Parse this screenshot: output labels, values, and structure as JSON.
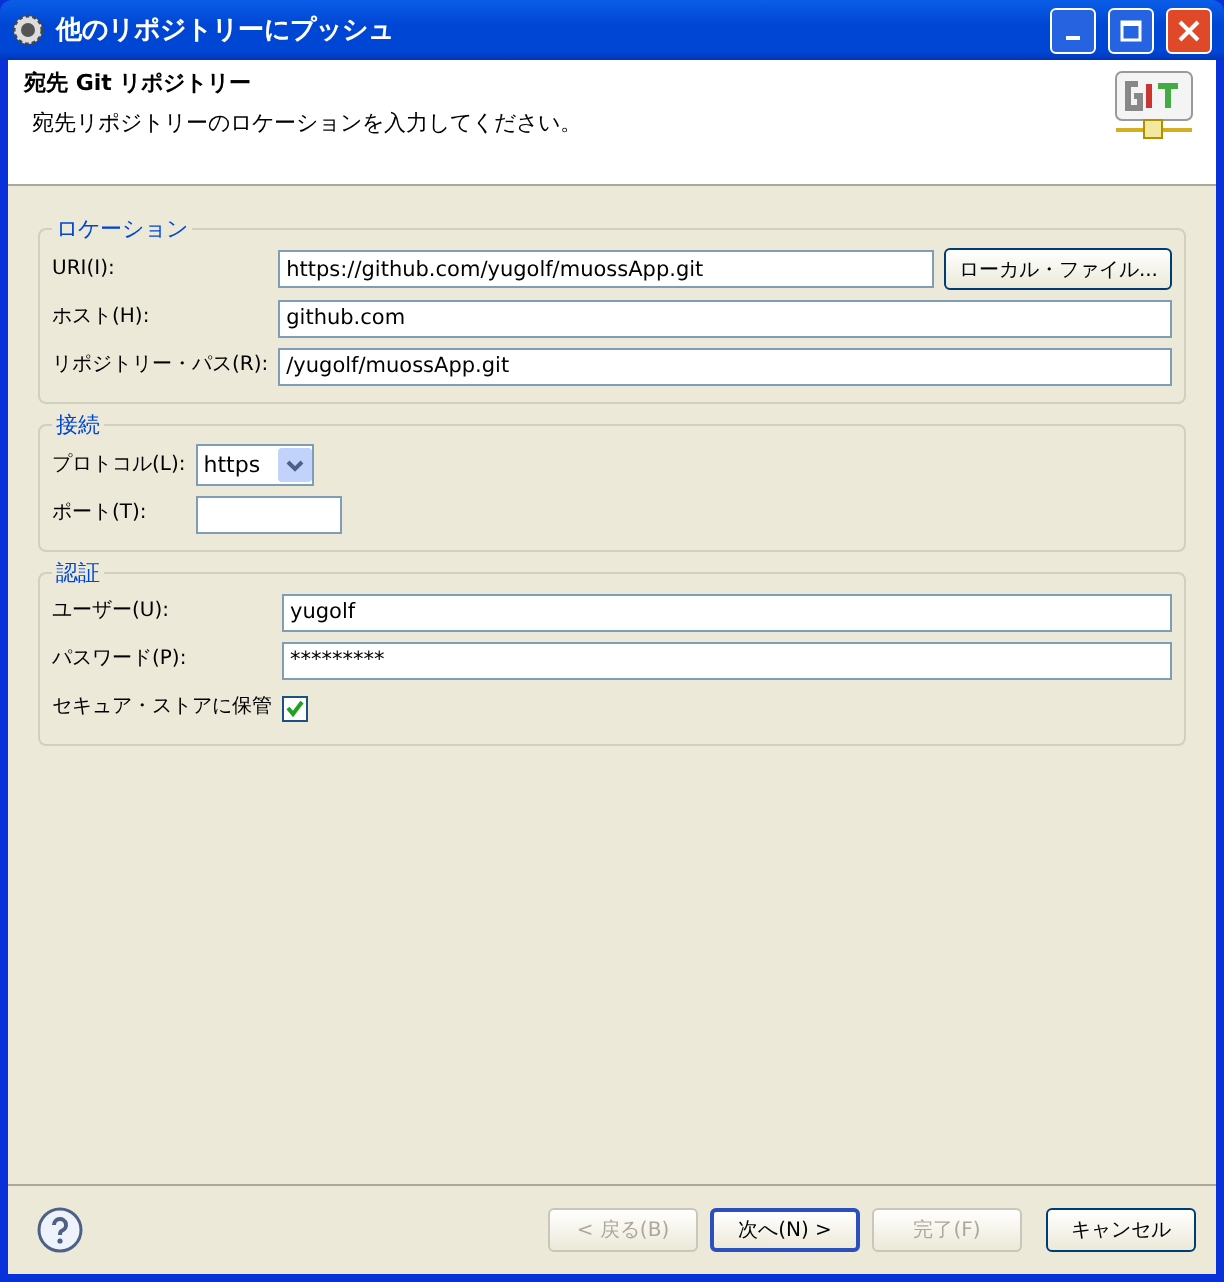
{
  "window": {
    "title": "他のリポジトリーにプッシュ"
  },
  "header": {
    "title": "宛先 Git リポジトリー",
    "description": "宛先リポジトリーのロケーションを入力してください。"
  },
  "groups": [
    {
      "title": "ロケーション",
      "fields": [
        {
          "kind": "text",
          "label": "URI(I):",
          "value": "https://github.com/yugolf/muossApp.git",
          "button": "ローカル・ファイル..."
        },
        {
          "kind": "text",
          "label": "ホスト(H):",
          "value": "github.com"
        },
        {
          "kind": "text",
          "label": "リポジトリー・パス(R):",
          "value": "/yugolf/muossApp.git"
        }
      ]
    },
    {
      "title": "接続",
      "fields": [
        {
          "kind": "select",
          "label": "プロトコル(L):",
          "value": "https"
        },
        {
          "kind": "short",
          "label": "ポート(T):"
        }
      ]
    },
    {
      "title": "認証",
      "fields": [
        {
          "kind": "text",
          "label": "ユーザー(U):",
          "value": "yugolf"
        },
        {
          "kind": "text",
          "label": "パスワード(P):",
          "value": "*********"
        },
        {
          "kind": "checkbox",
          "label": "セキュア・ストアに保管",
          "checked": true
        }
      ]
    }
  ],
  "buttons": [
    {
      "label": "< 戻る(B)",
      "disabled": true,
      "default": false
    },
    {
      "label": "次へ(N) >",
      "disabled": false,
      "default": true
    },
    {
      "label": "完了(F)",
      "disabled": true,
      "default": false
    },
    {
      "label": "キャンセル",
      "disabled": false,
      "default": false
    }
  ]
}
